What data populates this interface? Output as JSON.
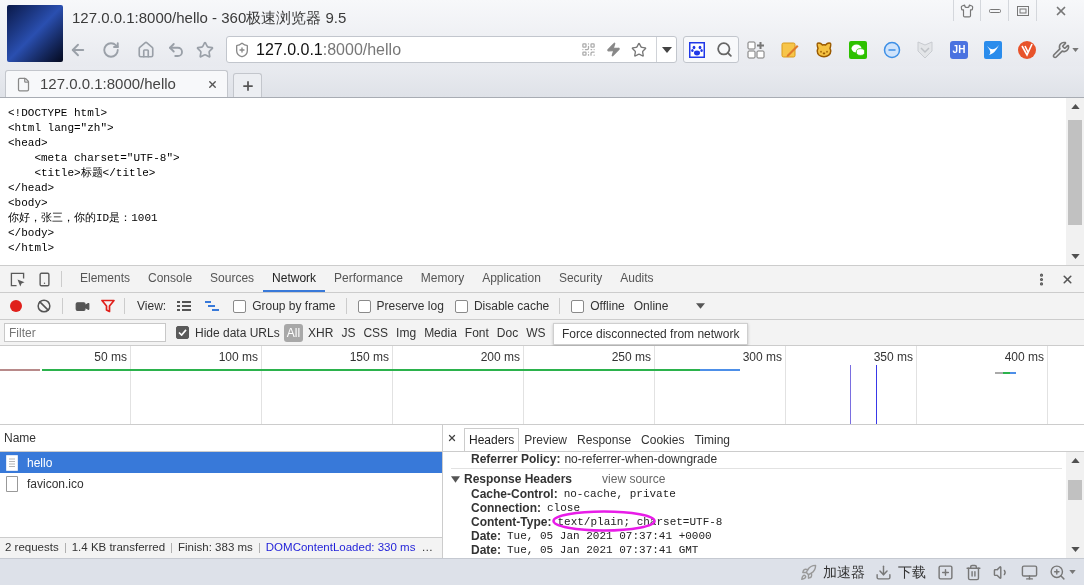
{
  "window": {
    "title": "127.0.0.1:8000/hello - 360极速浏览器 9.5"
  },
  "address_bar": {
    "host": "127.0.0.1",
    "path": ":8000/hello"
  },
  "toolbar": {
    "extension_label": "JH"
  },
  "tabs": [
    {
      "label": "127.0.0.1:8000/hello",
      "selected": true
    }
  ],
  "page_source": {
    "lines": [
      "<!DOCTYPE html>",
      "<html lang=\"zh\">",
      "<head>",
      "    <meta charset=\"UTF-8\">",
      "    <title>标题</title>",
      "</head>",
      "<body>",
      "你好，张三，你的ID是：1001",
      "</body>",
      "</html>"
    ]
  },
  "devtools": {
    "tabs": [
      {
        "label": "Elements",
        "selected": false
      },
      {
        "label": "Console",
        "selected": false
      },
      {
        "label": "Sources",
        "selected": false
      },
      {
        "label": "Network",
        "selected": true
      },
      {
        "label": "Performance",
        "selected": false
      },
      {
        "label": "Memory",
        "selected": false
      },
      {
        "label": "Application",
        "selected": false
      },
      {
        "label": "Security",
        "selected": false
      },
      {
        "label": "Audits",
        "selected": false
      }
    ],
    "toolbar": {
      "recording": true,
      "filter_active": true,
      "view_label": "View:",
      "checkbox_groups": [
        [
          {
            "label": "Group by frame",
            "checked": false
          }
        ],
        [
          {
            "label": "Preserve log",
            "checked": false
          },
          {
            "label": "Disable cache",
            "checked": false
          }
        ],
        [
          {
            "label": "Offline",
            "checked": false
          }
        ]
      ],
      "throttling": "Online"
    },
    "filter": {
      "placeholder": "Filter",
      "hide_data_urls": {
        "label": "Hide data URLs",
        "checked": true
      },
      "types": [
        {
          "label": "All",
          "selected": true
        },
        {
          "label": "XHR",
          "selected": false
        },
        {
          "label": "JS",
          "selected": false
        },
        {
          "label": "CSS",
          "selected": false
        },
        {
          "label": "Img",
          "selected": false
        },
        {
          "label": "Media",
          "selected": false
        },
        {
          "label": "Font",
          "selected": false
        },
        {
          "label": "Doc",
          "selected": false
        },
        {
          "label": "WS",
          "selected": false
        }
      ]
    },
    "tooltip": "Force disconnected from network",
    "timeline": {
      "ticks": [
        "50 ms",
        "100 ms",
        "150 ms",
        "200 ms",
        "250 ms",
        "300 ms",
        "350 ms",
        "400 ms"
      ]
    },
    "requests": {
      "column": "Name",
      "rows": [
        {
          "name": "hello",
          "kind": "document",
          "selected": true
        },
        {
          "name": "favicon.ico",
          "kind": "other",
          "selected": false
        }
      ]
    },
    "summary": [
      {
        "text": "2 requests",
        "kind": "plain"
      },
      {
        "text": "1.4 KB transferred",
        "kind": "plain"
      },
      {
        "text": "Finish: 383 ms",
        "kind": "plain"
      },
      {
        "text": "DOMContentLoaded: 330 ms",
        "kind": "event"
      },
      {
        "text": "…",
        "kind": "more"
      }
    ],
    "details": {
      "tabs": [
        {
          "label": "Headers",
          "selected": true
        },
        {
          "label": "Preview",
          "selected": false
        },
        {
          "label": "Response",
          "selected": false
        },
        {
          "label": "Cookies",
          "selected": false
        },
        {
          "label": "Timing",
          "selected": false
        }
      ],
      "referrer_policy": {
        "name": "Referrer Policy:",
        "value": "no-referrer-when-downgrade"
      },
      "section": {
        "title": "Response Headers",
        "expanded": true,
        "link": "view source"
      },
      "headers": [
        {
          "name": "Cache-Control:",
          "value": "no-cache, private",
          "highlighted": false
        },
        {
          "name": "Connection:",
          "value": "close",
          "highlighted": false
        },
        {
          "name": "Content-Type:",
          "value": "text/plain; charset=UTF-8",
          "highlighted": true
        },
        {
          "name": "Date:",
          "value": "Tue, 05 Jan 2021 07:37:41 +0000",
          "highlighted": false
        },
        {
          "name": "Date:",
          "value": "Tue, 05 Jan 2021 07:37:41 GMT",
          "highlighted": false
        }
      ]
    }
  },
  "status_bar": {
    "accelerator": "加速器",
    "downloads": "下载"
  }
}
